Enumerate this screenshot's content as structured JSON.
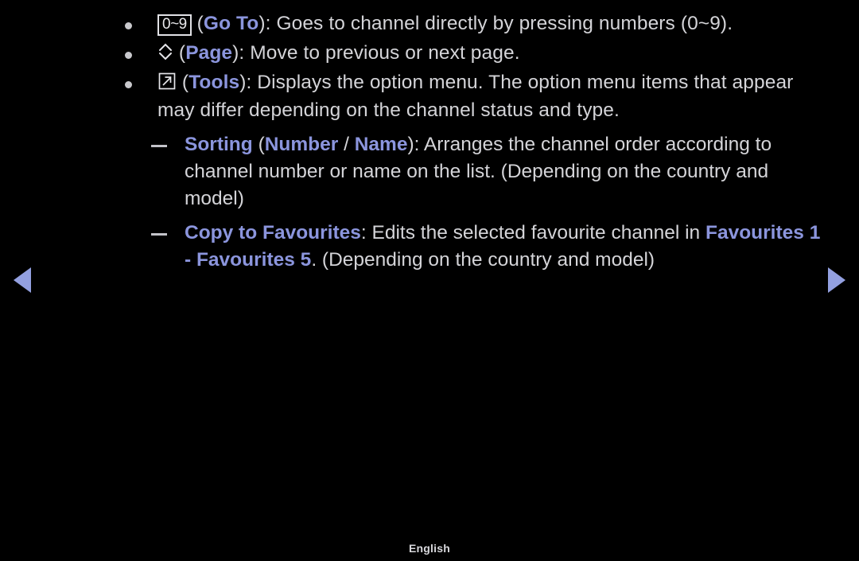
{
  "screen": {
    "background_color": "#000000",
    "text_color": "#d4d4d8",
    "accent_color": "#8b95dd",
    "arrow_color": "#93a0e0"
  },
  "bullets": [
    {
      "icon": "number-range-box-icon",
      "icon_label": "0~9",
      "key_name": "Go To",
      "open_paren": "(",
      "close_paren": "):",
      "description": " Goes to channel directly by pressing numbers (0~9)."
    },
    {
      "icon": "page-updown-chevron-icon",
      "icon_label": "",
      "key_name": "Page",
      "open_paren": "(",
      "close_paren": "):",
      "description": " Move to previous or next page."
    },
    {
      "icon": "tools-arrow-box-icon",
      "icon_label": "",
      "key_name": "Tools",
      "open_paren": "(",
      "close_paren": "):",
      "description": " Displays the option menu. The option menu items that appear may differ depending on the channel status and type."
    }
  ],
  "sub_items": [
    {
      "term": "Sorting",
      "space": " ",
      "paren_open": "(",
      "option_a": "Number",
      "separator": " / ",
      "option_b": "Name",
      "paren_close": ")",
      "colon": ":",
      "description": " Arranges the channel order according to channel number or name on the list. (Depending on the country and model)"
    },
    {
      "term": "Copy to Favourites",
      "colon": ":",
      "description": " Edits the selected favourite channel in ",
      "range_start": "Favourites 1",
      "range_dash": " - ",
      "range_end": "Favourites 5",
      "tail": ". (Depending on the country and model)"
    }
  ],
  "navigation": {
    "prev_label": "previous-page",
    "next_label": "next-page"
  },
  "footer": {
    "language": "English"
  }
}
